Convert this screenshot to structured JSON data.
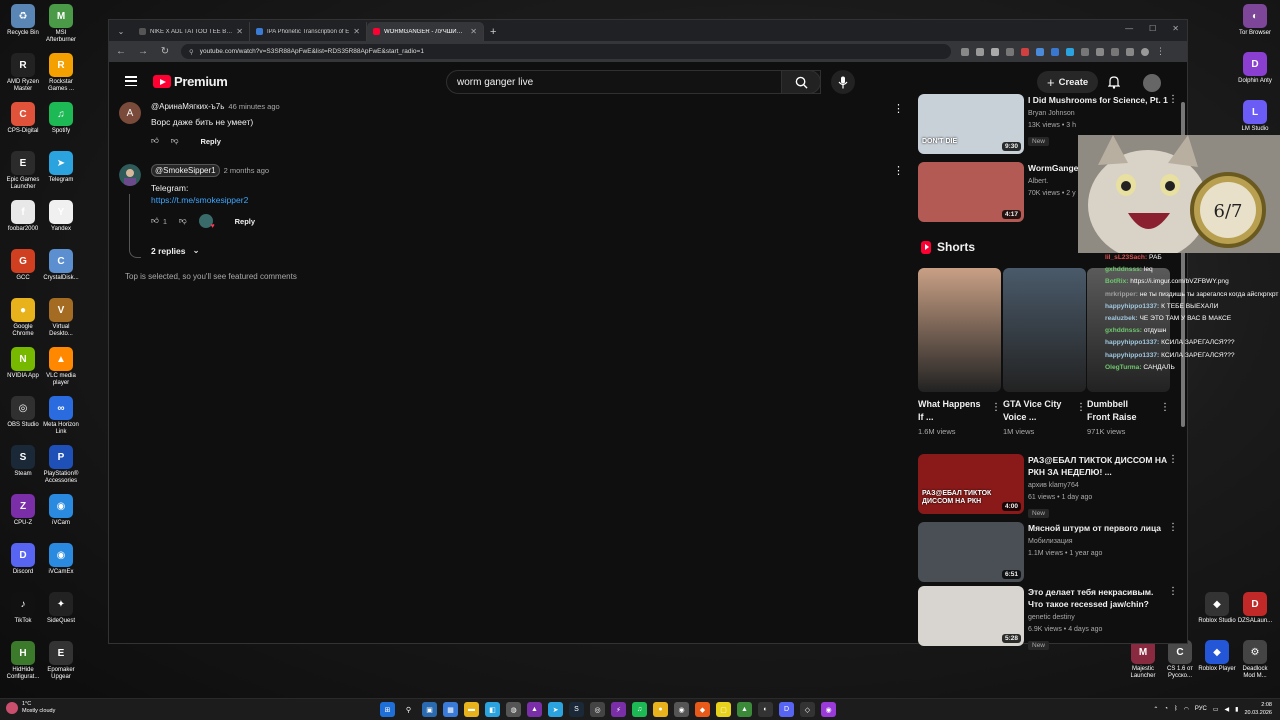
{
  "desktop": {
    "left_icons": [
      {
        "label": "Recycle Bin",
        "color": "#5a86b5",
        "glyph": "♻"
      },
      {
        "label": "MSI Afterburner",
        "color": "#4a9a48",
        "glyph": "M"
      },
      {
        "label": "AMD Ryzen Master",
        "color": "#222222",
        "glyph": "R"
      },
      {
        "label": "Rockstar Games ...",
        "color": "#f4a000",
        "glyph": "R"
      },
      {
        "label": "CPS-Digital",
        "color": "#e0523a",
        "glyph": "C"
      },
      {
        "label": "Spotify",
        "color": "#1db954",
        "glyph": "♫"
      },
      {
        "label": "Epic Games Launcher",
        "color": "#2b2b2b",
        "glyph": "E"
      },
      {
        "label": "Telegram",
        "color": "#2aa3df",
        "glyph": "➤"
      },
      {
        "label": "foobar2000",
        "color": "#e8e8e8",
        "glyph": "f"
      },
      {
        "label": "Yandex",
        "color": "#f0f0f0",
        "glyph": "Y"
      },
      {
        "label": "GCC",
        "color": "#d04020",
        "glyph": "G"
      },
      {
        "label": "CrystalDisk...",
        "color": "#5c8fcf",
        "glyph": "C"
      },
      {
        "label": "Google Chrome",
        "color": "#e8b21c",
        "glyph": "●"
      },
      {
        "label": "Virtual Deskto...",
        "color": "#a46b22",
        "glyph": "V"
      },
      {
        "label": "NVIDIA App",
        "color": "#76b900",
        "glyph": "N"
      },
      {
        "label": "VLC media player",
        "color": "#ff8800",
        "glyph": "▲"
      },
      {
        "label": "OBS Studio",
        "color": "#303030",
        "glyph": "◎"
      },
      {
        "label": "Meta Horizon Link",
        "color": "#2a6ce0",
        "glyph": "∞"
      },
      {
        "label": "Steam",
        "color": "#1b2838",
        "glyph": "S"
      },
      {
        "label": "PlayStation® Accessories",
        "color": "#1e50b8",
        "glyph": "P"
      },
      {
        "label": "CPU-Z",
        "color": "#7a2ea8",
        "glyph": "Z"
      },
      {
        "label": "iVCam",
        "color": "#2a8ae0",
        "glyph": "◉"
      },
      {
        "label": "Discord",
        "color": "#5865f2",
        "glyph": "D"
      },
      {
        "label": "iVCamEx",
        "color": "#2a8ae0",
        "glyph": "◉"
      },
      {
        "label": "TikTok",
        "color": "#111111",
        "glyph": "♪"
      },
      {
        "label": "SideQuest",
        "color": "#222222",
        "glyph": "✦"
      },
      {
        "label": "HidHide Configurat...",
        "color": "#3a7a2a",
        "glyph": "H"
      },
      {
        "label": "Epomaker Upgear",
        "color": "#333333",
        "glyph": "E"
      }
    ],
    "right_icons": [
      {
        "label": "Tor Browser",
        "color": "#7d4698",
        "glyph": "◐"
      },
      {
        "label": "Dolphin Anty",
        "color": "#8a3fd1",
        "glyph": "D"
      },
      {
        "label": "LM Studio",
        "color": "#6b5cf5",
        "glyph": "L"
      },
      {
        "label": "Roblox Studio",
        "color": "#333333",
        "glyph": "◆"
      },
      {
        "label": "DZSALaun...",
        "color": "#c12828",
        "glyph": "D"
      },
      {
        "label": "Majestic Launcher",
        "color": "#8a2a40",
        "glyph": "M"
      },
      {
        "label": "CS 1.6 от Русско...",
        "color": "#4a4a4a",
        "glyph": "C"
      },
      {
        "label": "Roblox Player",
        "color": "#2456d8",
        "glyph": "◆"
      },
      {
        "label": "Deadlock Mod M...",
        "color": "#444444",
        "glyph": "⚙"
      }
    ]
  },
  "browser": {
    "tabs": [
      {
        "title": "NIKE X ADL TATTOO TEE BOX B",
        "fav": "#555555",
        "active": false
      },
      {
        "title": "IPA Phonetic Transcription of E",
        "fav": "#3a7bd5",
        "active": false
      },
      {
        "title": "WORMGANGER - ЛУЧШИЙ КЛ",
        "fav": "#ff0033",
        "active": true
      }
    ],
    "url": "youtube.com/watch?v=S3SR88ApFwE&list=RDS35R88ApFwE&start_radio=1"
  },
  "youtube": {
    "logo_text": "Premium",
    "search_value": "worm ganger live",
    "create_label": "Create",
    "comments": [
      {
        "avatar_letter": "A",
        "avatar_color": "#7a4a3a",
        "author": "@АринаМягких-ъ7ь",
        "time": "46 minutes ago",
        "text": "Ворс даже бить не умеет)",
        "likes": "",
        "reply_label": "Reply"
      },
      {
        "avatar_letter": "",
        "avatar_color": "#3a6b6b",
        "author": "@SmokeSipper1",
        "time": "2 months ago",
        "text": "Telegram:",
        "link": "https://t.me/smokesipper2",
        "likes": "1",
        "reply_label": "Reply",
        "replies_label": "2 replies"
      }
    ],
    "notice": "Top is selected, so you'll see featured comments",
    "related_top": [
      {
        "title": "I Did Mushrooms for Science, Pt. 1",
        "channel": "Bryan Johnson",
        "meta": "13K views • 3 h",
        "badge": "New",
        "duration": "9:30",
        "thumb": "#c8d0d8",
        "thumb_text": "DON'T DIE"
      },
      {
        "title": "WormGanger ситуацию с",
        "channel": "Albert.",
        "meta": "70K views • 2 y",
        "badge": "",
        "duration": "4:17",
        "thumb": "#b35a55",
        "thumb_text": ""
      }
    ],
    "shorts_label": "Shorts",
    "shorts": [
      {
        "title": "What Happens If ...",
        "views": "1.6M views",
        "thumb": "#c9a085",
        "overlay": ""
      },
      {
        "title": "GTA Vice City Voice ...",
        "views": "1M views",
        "thumb": "#4a5a6a",
        "overlay": ""
      },
      {
        "title": "Dumbbell Front Raise",
        "views": "971K views",
        "thumb": "#5a5a5a",
        "overlay": ""
      }
    ],
    "related_bottom": [
      {
        "title": "РАЗ@ЕБАЛ ТИКТОК ДИССОМ НА РКН ЗА НЕДЕЛЮ! ...",
        "channel": "архив klamy764",
        "meta": "61 views • 1 day ago",
        "badge": "New",
        "duration": "4:00",
        "thumb": "#8a1a1a",
        "thumb_text": "РАЗ@ЕБАЛ ТИКТОК ДИССОМ НА РКН"
      },
      {
        "title": "Мясной штурм от первого лица",
        "channel": "Мобилизация",
        "meta": "1.1M views • 1 year ago",
        "badge": "",
        "duration": "6:51",
        "thumb": "#4a4f55",
        "thumb_text": ""
      },
      {
        "title": "Это делает тебя некрасивым. Что такое recessed jaw/chin?",
        "channel": "genetic destiny",
        "meta": "6.9K views • 4 days ago",
        "badge": "New",
        "duration": "5:28",
        "thumb": "#d8d4d0",
        "thumb_text": ""
      }
    ]
  },
  "overlay": {
    "pocket_watch_text": "6/7",
    "chat": [
      {
        "user": "lil_sL23Sach:",
        "text": "РАБ",
        "color": "#e05050"
      },
      {
        "user": "gxhddnsss:",
        "text": "leq",
        "color": "#6ec86e"
      },
      {
        "user": "BotRix:",
        "text": "https://i.imgur.com/bVZFBWY.png",
        "color": "#6ec86e"
      },
      {
        "user": "mrkripper:",
        "text": "не ты пиздишь ты зарегался когда айсгкргкрт канал создал",
        "color": "#a0a0a0"
      },
      {
        "user": "happyhippo1337:",
        "text": "К ТЕБЕ ВЫЕХАЛИ",
        "color": "#a0c8e0"
      },
      {
        "user": "realuzbek:",
        "text": "ЧЕ ЭТО ТАМ У ВАС В МАКСЕ",
        "color": "#a0c8e0"
      },
      {
        "user": "gxhddnsss:",
        "text": "отдушн",
        "color": "#6ec86e"
      },
      {
        "user": "happyhippo1337:",
        "text": "КСИЛА ЗАРЕГАЛСЯ???",
        "color": "#a0c8e0"
      },
      {
        "user": "happyhippo1337:",
        "text": "КСИЛА ЗАРЕГАЛСЯ???",
        "color": "#a0c8e0"
      },
      {
        "user": "OlegTurma:",
        "text": "САНДАЛЬ",
        "color": "#6ec86e"
      }
    ]
  },
  "taskbar": {
    "weather_temp": "1°C",
    "weather_desc": "Mostly cloudy",
    "lang": "РУС",
    "time": "2:08",
    "date": "20.03.2026"
  }
}
